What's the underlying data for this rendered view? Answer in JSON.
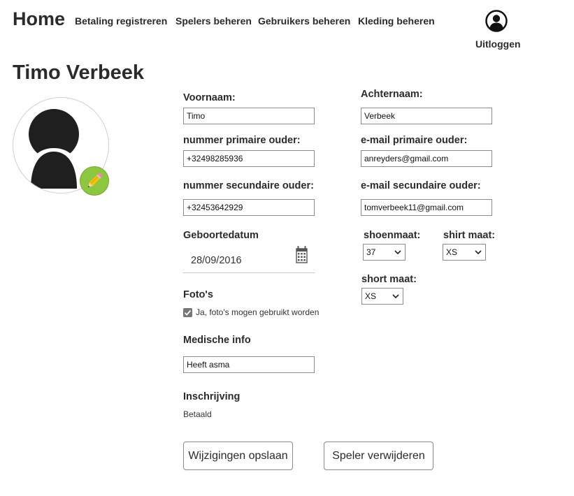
{
  "nav": {
    "home": "Home",
    "links": [
      "Betaling registreren",
      "Spelers beheren",
      "Gebruikers beheren",
      "Kleding beheren"
    ],
    "logout": "Uitloggen"
  },
  "player": {
    "name": "Timo Verbeek"
  },
  "form": {
    "voornaam": {
      "label": "Voornaam:",
      "value": "Timo"
    },
    "achternaam": {
      "label": "Achternaam:",
      "value": "Verbeek"
    },
    "phone_primary": {
      "label": "nummer primaire ouder:",
      "value": "+32498285936"
    },
    "email_primary": {
      "label": "e-mail primaire ouder:",
      "value": "anreyders@gmail.com"
    },
    "phone_secondary": {
      "label": "nummer secundaire ouder:",
      "value": "+32453642929"
    },
    "email_secondary": {
      "label": "e-mail secundaire ouder:",
      "value": "tomverbeek11@gmail.com"
    },
    "birthdate": {
      "label": "Geboortedatum",
      "value": "28/09/2016"
    },
    "shoe_size": {
      "label": "shoenmaat:",
      "value": "37"
    },
    "shirt_size": {
      "label": "shirt maat:",
      "value": "XS"
    },
    "short_size": {
      "label": "short maat:",
      "value": "XS"
    },
    "photos": {
      "label": "Foto's",
      "checkbox_label": "Ja, foto's mogen gebruikt worden",
      "checked": true
    },
    "medical": {
      "label": "Medische info",
      "value": "Heeft asma"
    },
    "registration": {
      "label": "Inschrijving",
      "value": "Betaald"
    }
  },
  "buttons": {
    "save": "Wijzigingen opslaan",
    "delete": "Speler verwijderen"
  },
  "colors": {
    "text": "#2b2b2b",
    "edit_badge": "#8dc63f",
    "avatar_silhouette": "#1f1f1f"
  },
  "icons": {
    "user": "user-circle-icon",
    "edit": "pencil-icon",
    "calendar": "calendar-icon"
  }
}
